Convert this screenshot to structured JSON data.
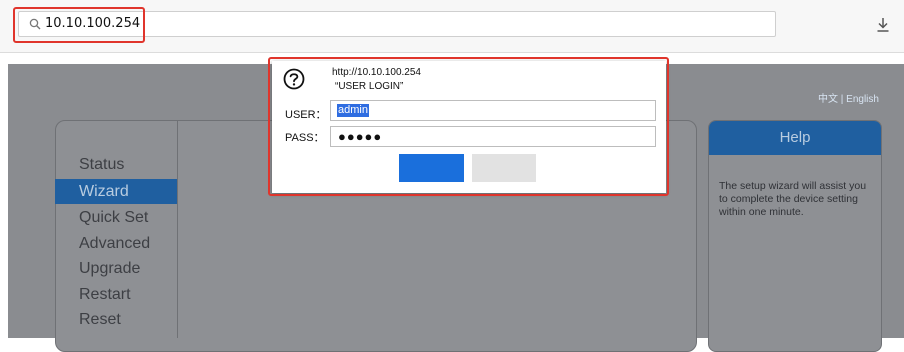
{
  "browser": {
    "url": "10.10.100.254",
    "icons": {
      "search": "search-icon",
      "download": "download-icon"
    }
  },
  "page": {
    "lang_chinese": "中文",
    "lang_separator": " | ",
    "lang_english": "English",
    "menu": [
      {
        "label": "Status",
        "active": false
      },
      {
        "label": "Wizard",
        "active": true
      },
      {
        "label": "Quick Set",
        "active": false
      },
      {
        "label": "Advanced",
        "active": false
      },
      {
        "label": "Upgrade",
        "active": false
      },
      {
        "label": "Restart",
        "active": false
      },
      {
        "label": "Reset",
        "active": false
      }
    ],
    "help": {
      "title": "Help",
      "text": "The setup wizard will assist you to complete the device setting within one minute."
    }
  },
  "login_dialog": {
    "url": "http://10.10.100.254",
    "realm": "“USER LOGIN”",
    "user_label": "USER：",
    "user_value": "admin",
    "pass_label": "PASS：",
    "pass_value": "●●●●●",
    "ok_label": "",
    "cancel_label": "",
    "icon": "question-icon"
  },
  "colors": {
    "highlight": "#e0352c",
    "accent": "#1f5fa0",
    "ok_button": "#1a6fdc",
    "page_background": "#8a8c90"
  }
}
